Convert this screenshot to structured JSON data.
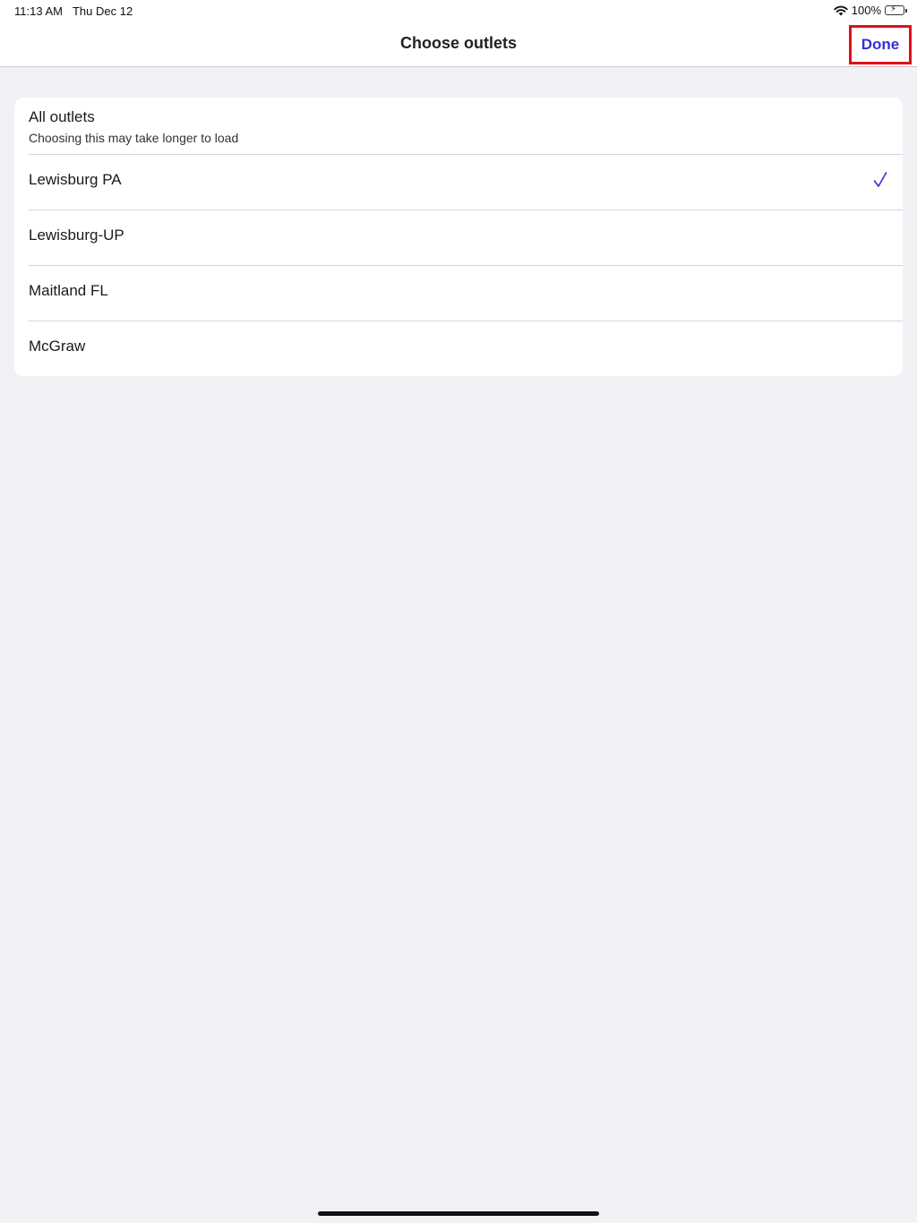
{
  "status_bar": {
    "time": "11:13 AM",
    "date": "Thu Dec 12",
    "battery_percent": "100%",
    "icons": [
      "wifi-icon",
      "battery-charging-icon"
    ]
  },
  "nav": {
    "title": "Choose outlets",
    "done_label": "Done"
  },
  "colors": {
    "accent": "#3a2bd8",
    "highlight_border": "#e0101a",
    "background": "#f1f1f6",
    "battery": "#34c759"
  },
  "outlets": {
    "all": {
      "label": "All outlets",
      "subtitle": "Choosing this may take longer to load"
    },
    "items": [
      {
        "label": "Lewisburg PA",
        "selected": true
      },
      {
        "label": "Lewisburg-UP",
        "selected": false
      },
      {
        "label": "Maitland FL",
        "selected": false
      },
      {
        "label": "McGraw",
        "selected": false
      }
    ]
  }
}
